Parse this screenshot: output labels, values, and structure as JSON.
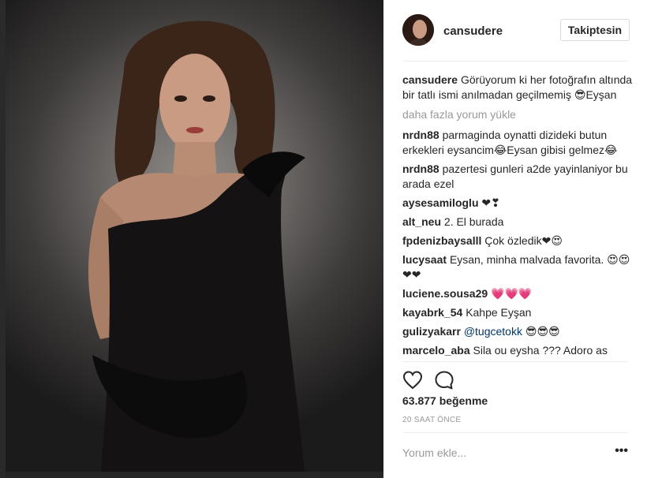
{
  "post": {
    "username": "cansudere",
    "follow_label": "Takiptesin",
    "caption_user": "cansudere",
    "caption_text": "Görüyorum ki her fotoğrafın altında bir tatlı ismi anılmadan geçilmemiş 😎Eyşan",
    "load_more": "daha fazla yorum yükle",
    "likes": "63.877 beğenme",
    "time": "20 SAAT ÖNCE",
    "comment_placeholder": "Yorum ekle...",
    "more_label": "•••"
  },
  "comments": [
    {
      "user": "nrdn88",
      "text": "parmaginda oynatti dizideki butun erkekleri eysancim😂Eysan gibisi gelmez😂"
    },
    {
      "user": "nrdn88",
      "text": "pazertesi gunleri a2de yayinlaniyor bu arada ezel"
    },
    {
      "user": "aysesamiloglu",
      "text": "❤❣"
    },
    {
      "user": "alt_neu",
      "text": "2. El burada"
    },
    {
      "user": "fpdenizbaysalll",
      "text": "Çok özledik❤😍"
    },
    {
      "user": "lucysaat",
      "text": "Eysan, minha malvada favorita. 😍😍❤❤"
    },
    {
      "user": "luciene.sousa29",
      "text": "💗💗💗"
    },
    {
      "user": "kayabrk_54",
      "text": "Kahpe Eyşan"
    },
    {
      "user": "gulizyakarr",
      "text": "😎😎😎",
      "mention": "@tugcetokk"
    },
    {
      "user": "marcelo_aba",
      "text": "Sila ou eysha ??? Adoro as"
    }
  ],
  "icons": {
    "like": "heart-icon",
    "comment": "comment-bubble-icon",
    "more": "more-options-icon"
  },
  "colors": {
    "background": "#ffffff",
    "divider": "#efefef",
    "muted_text": "#999999",
    "mention": "#003569"
  }
}
